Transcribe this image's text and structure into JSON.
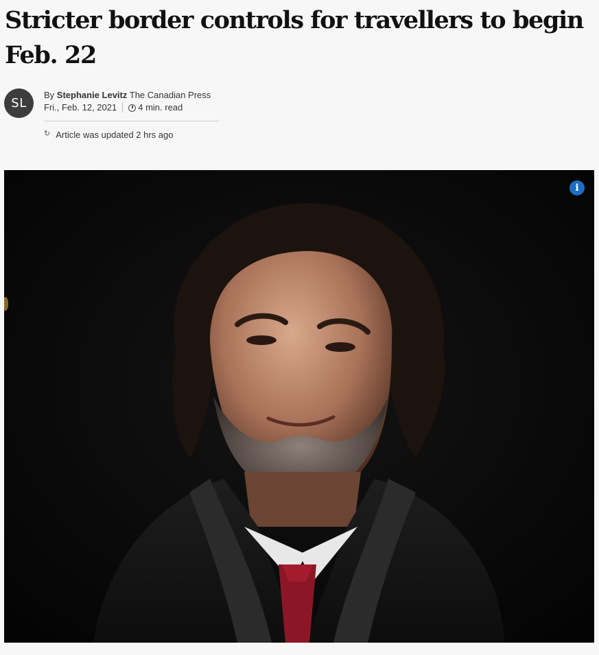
{
  "article": {
    "headline": "Stricter border controls for travellers to begin Feb. 22",
    "author": {
      "initials": "SL",
      "by_prefix": "By",
      "name": "Stephanie Levitz",
      "outlet": "The Canadian Press"
    },
    "date": "Fri., Feb. 12, 2021",
    "read_time": "4 min. read",
    "updated_text": "Article was updated 2 hrs ago"
  },
  "image": {
    "info_label": "i"
  },
  "icons": {
    "clock": "clock-icon",
    "refresh": "refresh-icon",
    "info": "info-icon"
  },
  "colors": {
    "background": "#f7f7f7",
    "avatar": "#3d3d3d",
    "info_button": "#1b6ec2"
  }
}
